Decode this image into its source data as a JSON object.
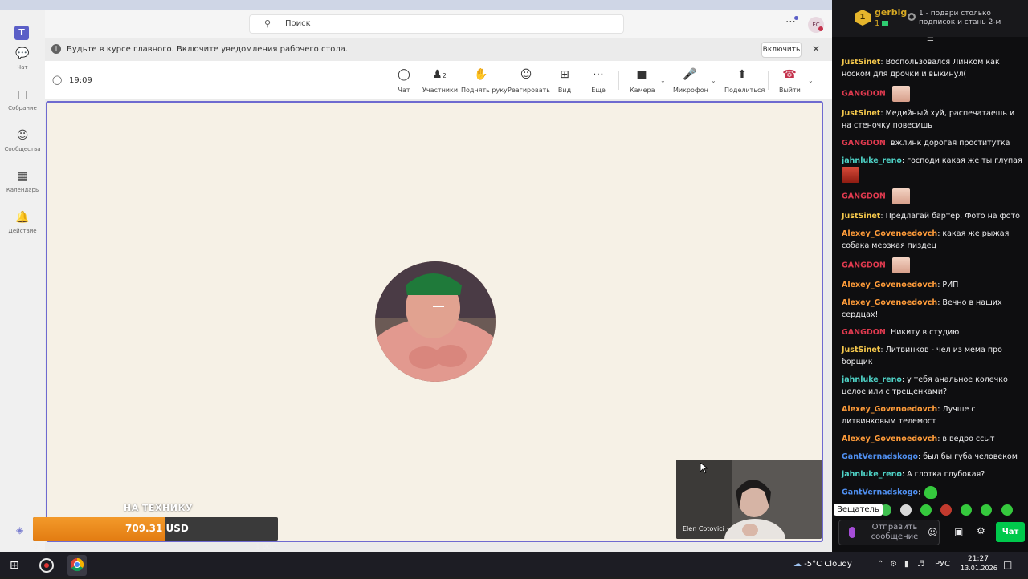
{
  "teams": {
    "search_placeholder": "Поиск",
    "avatar_initials": "EC",
    "rail": [
      {
        "label": "Чат",
        "icon": "chat-icon"
      },
      {
        "label": "Собрание",
        "icon": "camera-icon"
      },
      {
        "label": "Сообщества",
        "icon": "communities-icon"
      },
      {
        "label": "Календарь",
        "icon": "calendar-icon"
      },
      {
        "label": "Действие",
        "icon": "bell-icon"
      }
    ],
    "banner": {
      "text": "Будьте в курсе главного. Включите уведомления рабочего стола.",
      "button": "Включить"
    },
    "meeting": {
      "time": "19:09",
      "participants_count": "2",
      "tools": [
        {
          "label": "Чат",
          "icon": "chat-icon"
        },
        {
          "label": "Участники",
          "icon": "participants-icon"
        },
        {
          "label": "Поднять руку",
          "icon": "raise-hand-icon"
        },
        {
          "label": "Реагировать",
          "icon": "react-icon"
        },
        {
          "label": "Вид",
          "icon": "grid-view-icon"
        },
        {
          "label": "Еще",
          "icon": "more-icon"
        },
        {
          "label": "Камера",
          "icon": "video-camera-icon"
        },
        {
          "label": "Микрофон",
          "icon": "microphone-icon"
        },
        {
          "label": "Поделиться",
          "icon": "share-icon"
        },
        {
          "label": "Выйти",
          "icon": "hang-up-icon"
        }
      ]
    },
    "camera_tile": {
      "name": "Elen Cotovici ···"
    }
  },
  "donation": {
    "label": "НА ТЕХНИКУ",
    "amount": "709.31 USD",
    "progress": 0.709,
    "min": "0",
    "goal": "1 000"
  },
  "chat": {
    "header": {
      "badge": "1",
      "user": "gerbig",
      "count": "1",
      "text": "1 - подари столько подписок и стань 2-м"
    },
    "colors": {
      "red": "#e03a4f",
      "yellow": "#f5c84c",
      "cyan": "#4fd4c8",
      "orange": "#ff9c3a",
      "blue": "#4f8ff0"
    },
    "messages": [
      {
        "user": "JustSinet",
        "color": "#f5c84c",
        "text": "Воспользовался Линком как носком для дрочки и выкинул(",
        "emote": ""
      },
      {
        "user": "GANGDON",
        "color": "#e03a4f",
        "text": "",
        "emote": "face"
      },
      {
        "user": "JustSinet",
        "color": "#f5c84c",
        "text": "Медийный хуй, распечатаешь и на стеночку повесишь",
        "emote": ""
      },
      {
        "user": "GANGDON",
        "color": "#e03a4f",
        "text": "вжлинк дорогая проститутка",
        "emote": ""
      },
      {
        "user": "jahnluke_reno",
        "color": "#4fd4c8",
        "text": "господи какая же ты глупая",
        "emote": "red"
      },
      {
        "user": "GANGDON",
        "color": "#e03a4f",
        "text": "",
        "emote": "face"
      },
      {
        "user": "JustSinet",
        "color": "#f5c84c",
        "text": "Предлагай бартер. Фото на фото",
        "emote": ""
      },
      {
        "user": "Alexey_Govenoedovch",
        "color": "#ff9c3a",
        "text": "какая же рыжая собака мерзкая пиздец",
        "emote": ""
      },
      {
        "user": "GANGDON",
        "color": "#e03a4f",
        "text": "",
        "emote": "face"
      },
      {
        "user": "Alexey_Govenoedovch",
        "color": "#ff9c3a",
        "text": "РИП",
        "emote": ""
      },
      {
        "user": "Alexey_Govenoedovch",
        "color": "#ff9c3a",
        "text": "Вечно в наших сердцах!",
        "emote": ""
      },
      {
        "user": "GANGDON",
        "color": "#e03a4f",
        "text": "Никиту в студию",
        "emote": ""
      },
      {
        "user": "JustSinet",
        "color": "#f5c84c",
        "text": "Литвинков - чел из мема про борщик",
        "emote": ""
      },
      {
        "user": "jahnluke_reno",
        "color": "#4fd4c8",
        "text": "у тебя анальное колечко целое или с трещенками?",
        "emote": ""
      },
      {
        "user": "Alexey_Govenoedovch",
        "color": "#ff9c3a",
        "text": "Лучше с литвинковым телемост",
        "emote": ""
      },
      {
        "user": "Alexey_Govenoedovch",
        "color": "#ff9c3a",
        "text": "в ведро ссыт",
        "emote": ""
      },
      {
        "user": "GantVernadskogo",
        "color": "#4f8ff0",
        "text": "был бы губа человеком",
        "emote": ""
      },
      {
        "user": "jahnluke_reno",
        "color": "#4fd4c8",
        "text": "А глотка глубокая?",
        "emote": ""
      },
      {
        "user": "GantVernadskogo",
        "color": "#4f8ff0",
        "text": "",
        "emote": "green"
      }
    ],
    "tooltip": "Вещатель",
    "input_placeholder": "Отправить сообщение",
    "chat_button": "Чат"
  },
  "taskbar": {
    "weather": "-5°C  Cloudy",
    "lang": "РУС",
    "time": "21:27",
    "date": "13.01.2026"
  }
}
